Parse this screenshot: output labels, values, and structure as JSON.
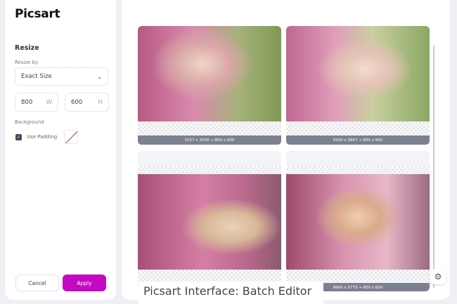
{
  "app": {
    "logo": "Picsart"
  },
  "sidebar": {
    "section_title": "Resize",
    "resize_by_label": "Resize by",
    "resize_by_value": "Exact Size",
    "width_value": "800",
    "width_unit": "W",
    "height_value": "600",
    "height_unit": "H",
    "background_label": "Background",
    "use_padding_label": "Use Padding",
    "use_padding_checked": true,
    "cancel_label": "Cancel",
    "apply_label": "Apply"
  },
  "colors": {
    "accent": "#c20ac2",
    "label_bar": "#7d8090"
  },
  "images": [
    {
      "label": "5157 x 3438 → 800 x 600"
    },
    {
      "label": "5500 x 3667 → 800 x 600"
    },
    {
      "label": ""
    },
    {
      "label": "8660 x 5773 → 800 x 600"
    }
  ],
  "caption": "Picsart Interface: Batch Editor"
}
